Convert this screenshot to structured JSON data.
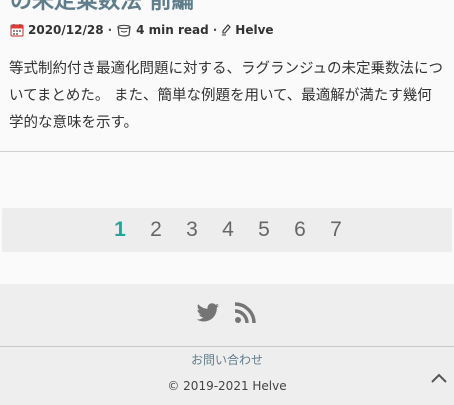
{
  "post": {
    "title": "の未定乗数法 前編",
    "date": "2020/12/28",
    "read_time": "4 min read",
    "author": "Helve",
    "excerpt": "等式制約付き最適化問題に対する、ラグランジュの未定乗数法についてまとめた。 また、簡単な例題を用いて、最適解が満たす幾何学的な意味を示す。"
  },
  "meta": {
    "separator": "·",
    "icons": [
      "calendar-icon",
      "coffee-cup-icon",
      "pen-icon"
    ]
  },
  "pagination": {
    "pages": [
      "1",
      "2",
      "3",
      "4",
      "5",
      "6",
      "7"
    ],
    "current": "1"
  },
  "footer": {
    "social_icons": [
      "twitter-icon",
      "rss-icon"
    ],
    "contact_label": "お問い合わせ",
    "copyright": "© 2019-2021 Helve"
  },
  "colors": {
    "accent": "#26a69a",
    "title": "#607d8b",
    "footer_bg": "#eeeeee",
    "icon_gray": "#757575"
  }
}
